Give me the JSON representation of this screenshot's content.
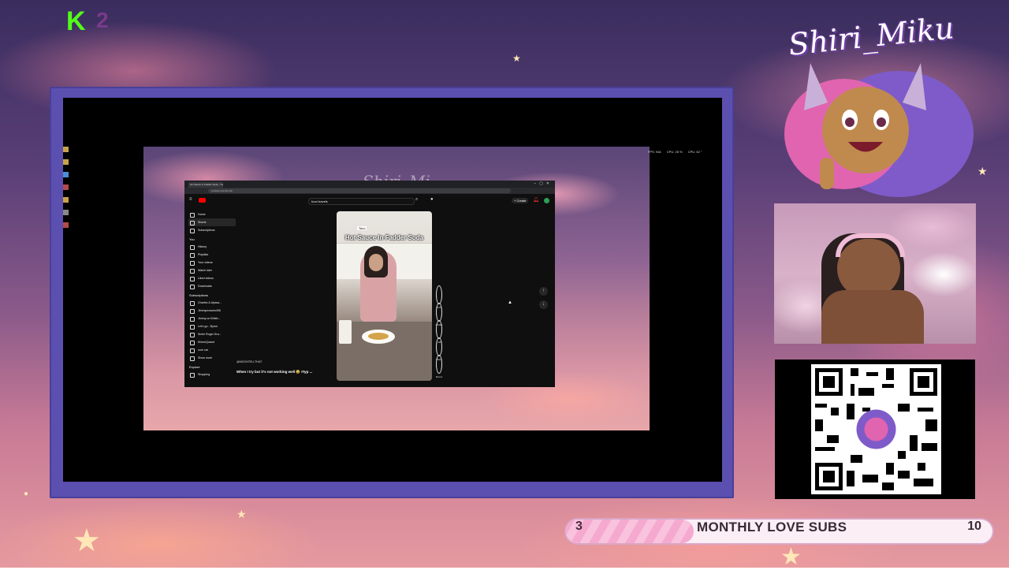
{
  "overlay": {
    "kick_badge_icon": "kick-logo-icon",
    "kick_count": "2",
    "streamer_name": "Shiri_Miku",
    "goal": {
      "current": "3",
      "label": "MONTHLY LOVE SUBS",
      "target": "10",
      "progress": 0.3
    },
    "colors": {
      "frame": "#5b4fb0",
      "goal_fill": "#f6a9cf",
      "kick_green": "#53fc18"
    }
  },
  "desktop": {
    "ghost_text": "Shiri_Mi",
    "stats": [
      "FPS: N/A",
      "CPU: 26 %",
      "CPU: 62 °"
    ]
  },
  "browser": {
    "tab_title": "Hot Sauce In Fadder Soda - YouTube",
    "url": "youtube.com/shorts/",
    "search_value": "food travels",
    "create_label": "+ Create",
    "sidebar": {
      "main": [
        "Home",
        "Shorts",
        "Subscriptions"
      ],
      "you_header": "You",
      "you": [
        "History",
        "Playlists",
        "Your videos",
        "Watch later",
        "Liked videos",
        "Downloads"
      ],
      "subs_header": "Subscriptions",
      "subs": [
        "Charles & Alyssa...",
        "Jimmycrosses408",
        "Jimmy on Britsh...",
        "Let's go - Byron",
        "Smile Roger Dra...",
        "KhiemQuand",
        "core cat",
        "Show more"
      ],
      "explore_header": "Explore",
      "explore": [
        "Shopping"
      ]
    },
    "short": {
      "tag": "Taco",
      "caption": "Hot Sauce In Fadder Soda",
      "channel": "@MOONTELLTHAT",
      "title": "When I try but it's not working well 😂 #typ ...",
      "actions": [
        "527K",
        "Dislike",
        "1,905",
        "Share",
        "Remix"
      ]
    }
  }
}
